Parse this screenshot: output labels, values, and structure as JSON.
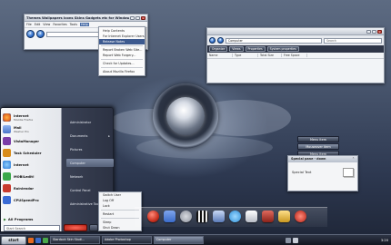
{
  "ie_window": {
    "title": "Themes Wallpapers Icons Skins Gadgets etc for Windows XP & Vista - Windows Internet Explorer",
    "menu": [
      "File",
      "Edit",
      "View",
      "Favorites",
      "Tools",
      "Help"
    ],
    "active_menu": "Help",
    "help_menu": [
      "Help Contents",
      "For Internet Explorer Users",
      "Release Notes",
      "Report Broken Web Site...",
      "Report Web Forgery...",
      "Check for Updates...",
      "About Mozilla Firefox"
    ],
    "highlighted_item": "Release Notes"
  },
  "explorer_window": {
    "address": "Computer",
    "search_placeholder": "Search",
    "toolbar": [
      "Organize",
      "Views",
      "Properties",
      "System properties"
    ],
    "columns": [
      "Name",
      "Type",
      "Total Size",
      "Free Space"
    ]
  },
  "start_menu": {
    "pinned": [
      {
        "label": "Internet",
        "sub": "Mozilla Firefox",
        "color": "#e66a1f"
      },
      {
        "label": "Mail",
        "sub": "Washer Pro",
        "color": "#4a74c9"
      }
    ],
    "recent": [
      {
        "label": "VistaManager",
        "color": "#7a3da8"
      },
      {
        "label": "Task Scheduler",
        "color": "#d98c1a"
      },
      {
        "label": "Internet",
        "color": "#2e7bd6"
      },
      {
        "label": "MOBILedit!",
        "color": "#3aa84a"
      },
      {
        "label": "Rainlendar",
        "color": "#c83a2e"
      },
      {
        "label": "CPUSpeedPro",
        "color": "#3a6bd6"
      }
    ],
    "all_programs": "All Programs",
    "search_placeholder": "Start Search",
    "right_items": [
      "Administrator",
      "Documents",
      "Pictures",
      "Computer",
      "Network",
      "Control Panel",
      "Administrative Tools"
    ],
    "highlighted_right": "Computer"
  },
  "shutdown_menu": [
    "Switch User",
    "Log Off",
    "Lock",
    "Restart",
    "Sleep",
    "Shut Down"
  ],
  "panel_buttons": [
    "Menu item",
    "Mouseover item",
    "Menu item"
  ],
  "special_panel": {
    "title": "Special pane - down",
    "text": "Special Text"
  },
  "taskbar": {
    "start_label": "start",
    "tasks": [
      {
        "label": "Stardock Skin Studi...",
        "active": false
      },
      {
        "label": "Adobe Photoshop",
        "active": false
      },
      {
        "label": "Computer",
        "active": true
      }
    ],
    "clock": "3:20"
  },
  "dock_icons": [
    {
      "name": "red-ball-icon",
      "color": "#c8301f"
    },
    {
      "name": "blue-folder-icon",
      "color": "#3a6bc9"
    },
    {
      "name": "gear-icon",
      "color": "#8a8f9a"
    },
    {
      "name": "clapper-icon",
      "color": "#222a38"
    },
    {
      "name": "monitor-icon",
      "color": "#5a7ab8"
    },
    {
      "name": "globe-icon",
      "color": "#2f8fd8"
    },
    {
      "name": "music-icon",
      "color": "#d8d8e0"
    },
    {
      "name": "trash-icon",
      "color": "#b73a2e"
    },
    {
      "name": "lock-icon",
      "color": "#e1b43a"
    }
  ]
}
